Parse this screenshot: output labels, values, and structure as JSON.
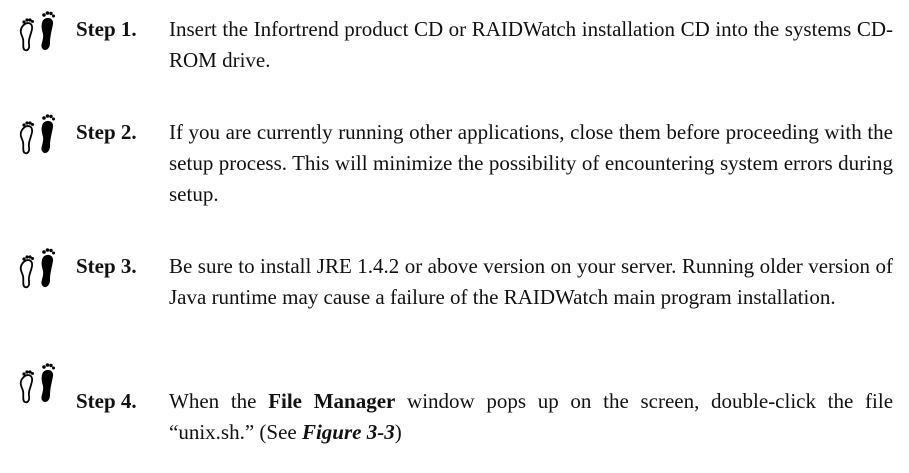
{
  "steps": [
    {
      "label": "Step 1.",
      "icon": "footprints-icon",
      "text": "Insert the Infortrend product CD or RAIDWatch installation CD into the systems CD-ROM drive."
    },
    {
      "label": "Step 2.",
      "icon": "footprints-icon",
      "text": "If you are currently running other applications, close them before proceeding with the setup process. This will minimize the possibility of encountering system errors during setup."
    },
    {
      "label": "Step 3.",
      "icon": "footprints-icon",
      "text": "Be sure to install JRE 1.4.2 or above version on your server. Running older version of Java runtime may cause a failure of the RAIDWatch main program installation."
    },
    {
      "label": "Step 4.",
      "icon": "footprints-icon",
      "text_before": "When the ",
      "text_bold": "File Manager",
      "text_middle": " window pops up on the screen, double-click the file “unix.sh.” (See ",
      "text_ref": "Figure 3-3",
      "text_after": ")"
    }
  ]
}
